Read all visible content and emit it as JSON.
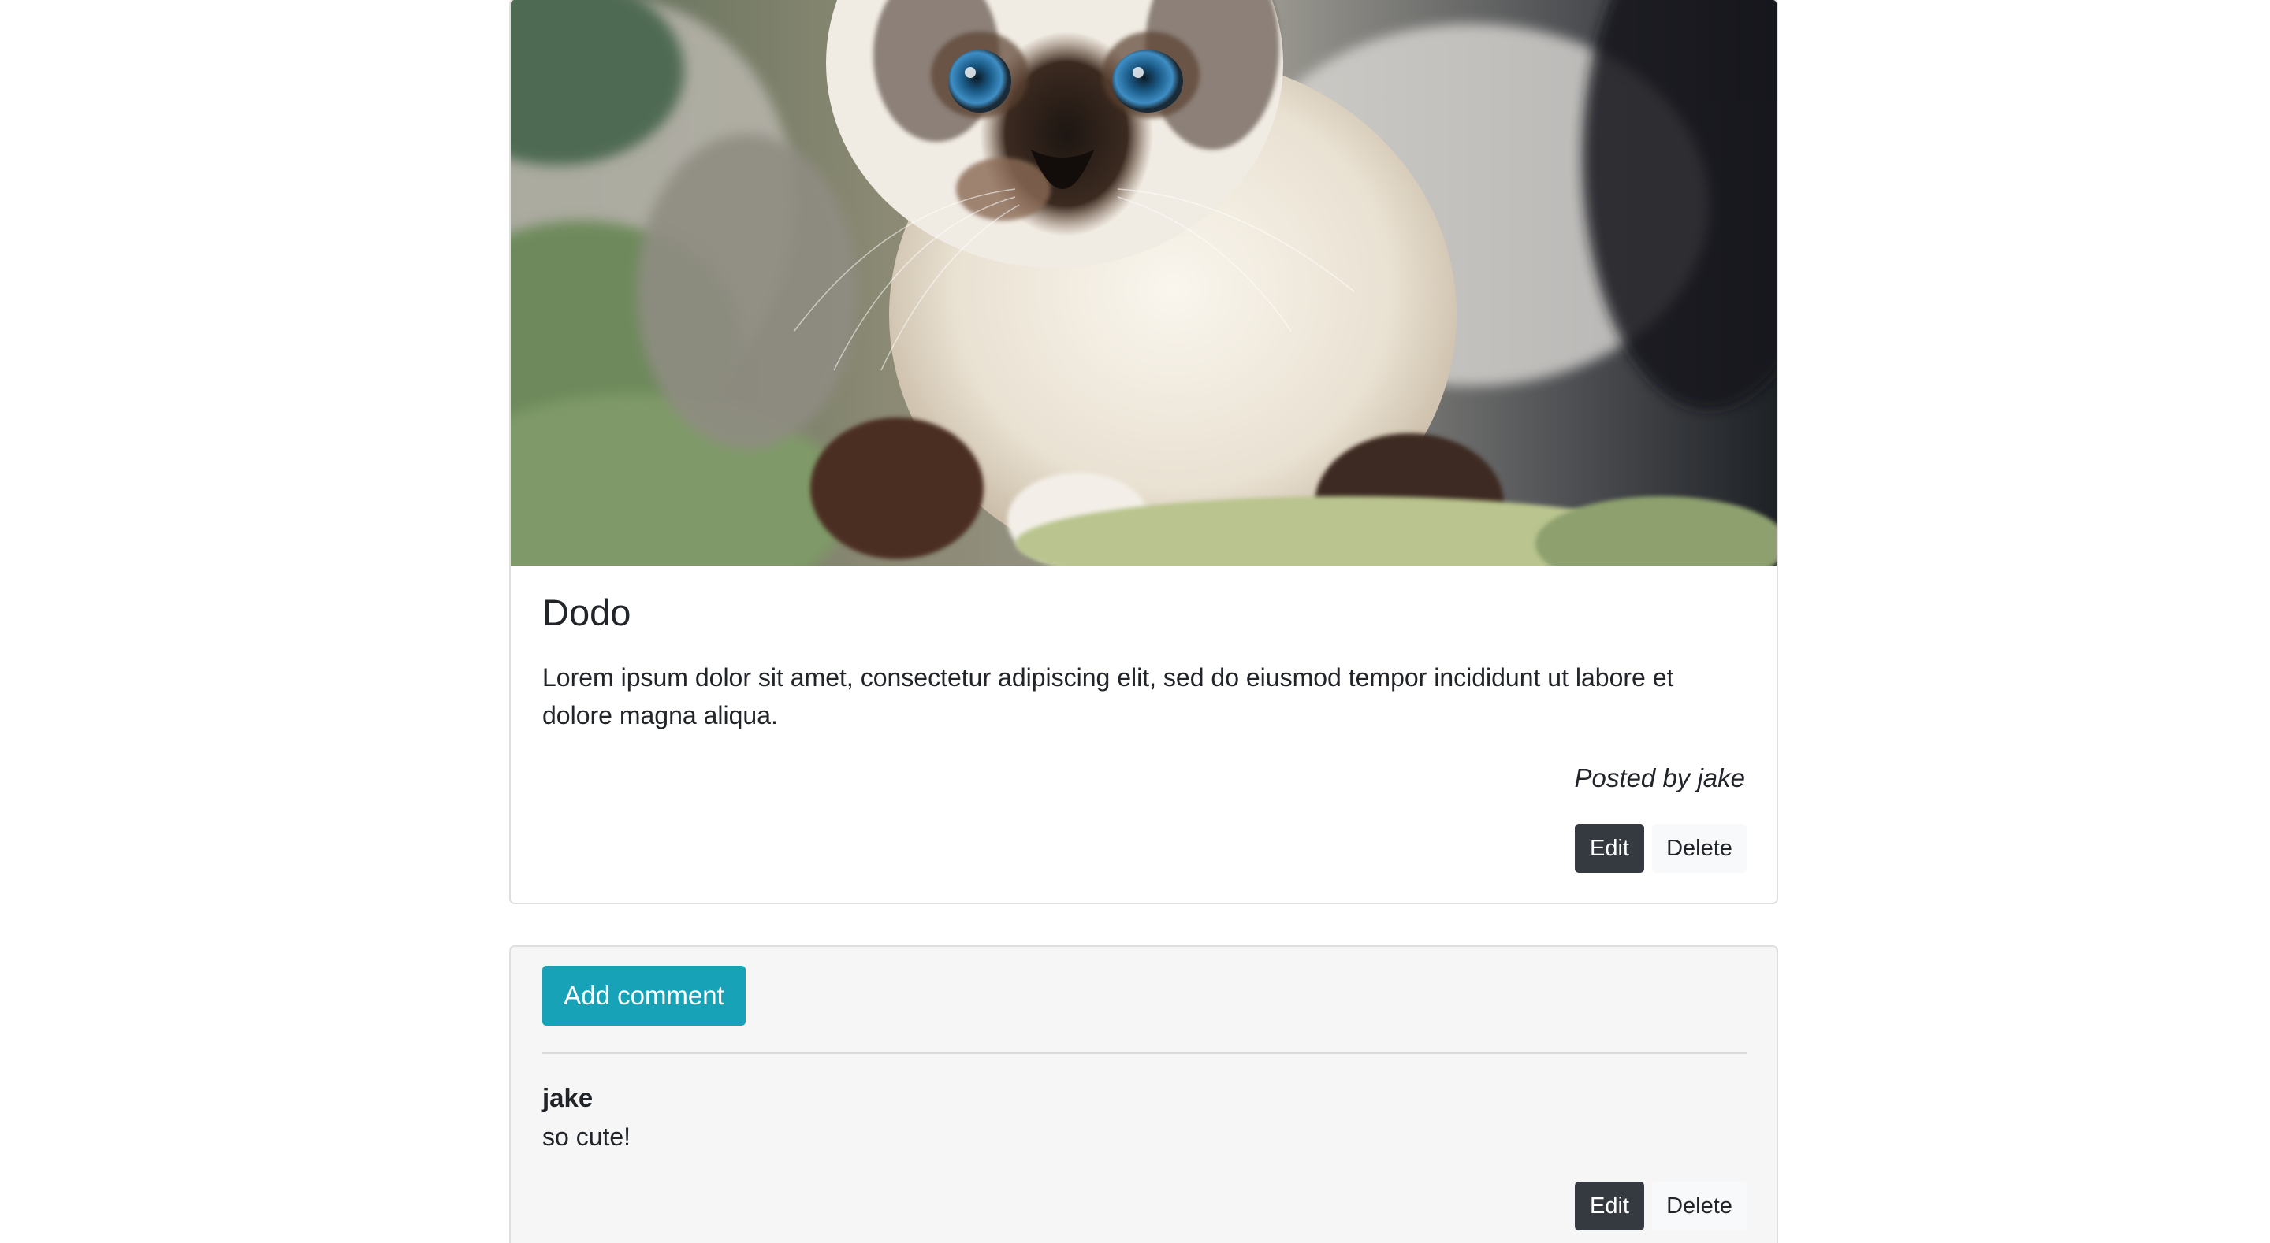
{
  "post": {
    "image_alt": "Siamese kitten lying on a green knitted blanket",
    "title": "Dodo",
    "body": "Lorem ipsum dolor sit amet, consectetur adipiscing elit, sed do eiusmod tempor incididunt ut labore et dolore magna aliqua.",
    "author_line": "Posted by jake",
    "edit_label": "Edit",
    "delete_label": "Delete"
  },
  "comments": {
    "add_label": "Add comment",
    "items": [
      {
        "author": "jake",
        "text": "so cute!",
        "edit_label": "Edit",
        "delete_label": "Delete"
      }
    ]
  },
  "colors": {
    "dark_button": "#343a40",
    "light_button": "#f8f9fa",
    "info_button": "#17a2b8",
    "card_border": "#dfdfdf",
    "comments_background": "#f6f6f6"
  }
}
